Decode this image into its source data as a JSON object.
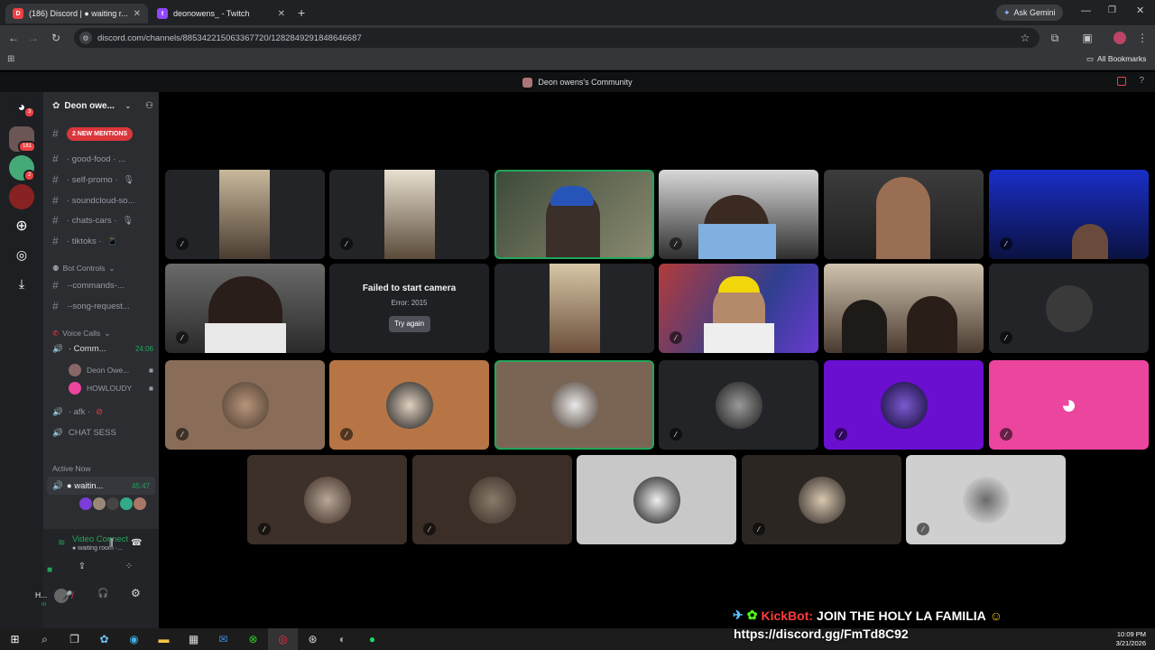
{
  "browser": {
    "tabs": [
      {
        "label": "(186) Discord | ● waiting r..."
      },
      {
        "label": "deonowens_ - Twitch"
      }
    ],
    "ask_gemini": "Ask Gemini",
    "url": "discord.com/channels/885342215063367720/1282849291848646687",
    "all_bookmarks": "All Bookmarks"
  },
  "discord": {
    "window_title": "Deon owens's Community",
    "server_name": "Deon owe...",
    "new_mentions": "2 NEW MENTIONS",
    "rail_badges": {
      "dm": "3",
      "first": "181",
      "second": "2"
    },
    "channels": [
      {
        "name": "· good-food · ...",
        "suffix": ""
      },
      {
        "name": "· self-promo ·",
        "suffix": "🎙"
      },
      {
        "name": "· soundcloud-so...",
        "suffix": ""
      },
      {
        "name": "· chats-cars ·",
        "suffix": "🎙"
      },
      {
        "name": "· tiktoks ·",
        "suffix": "📱"
      }
    ],
    "bot_controls": "Bot Controls",
    "bot_channels": [
      "·-commands-...",
      "·-song-request..."
    ],
    "voice_calls": "Voice Calls",
    "voice_channel": {
      "name": "· Comm...",
      "time": "24:06"
    },
    "voice_users": [
      "Deon Owe...",
      "HOWLOUDY"
    ],
    "afk": "· afk ·",
    "chat_sess": "CHAT SESS",
    "active_now": "Active Now",
    "active_item": {
      "name": "● waitin...",
      "time": "45:47"
    },
    "video_connected": "Video Connected",
    "video_sub": "● waiting room ·...",
    "user_short": "H...",
    "user_status": "In",
    "camera_error": {
      "title": "Failed to start camera",
      "code": "Error: 2015",
      "retry": "Try again"
    }
  },
  "overlay": {
    "kickbot_label": "KickBot:",
    "kickbot_text": "JOIN THE HOLY LA FAMILIA",
    "invite": "https://discord.gg/FmTd8C92"
  },
  "taskbar": {
    "time": "10:09 PM",
    "date": "3/21/2026"
  },
  "colors": {
    "accent": "#5865f2",
    "speaking": "#23a55a",
    "mention": "#ed4245",
    "discord_pink": "#eb459e"
  }
}
